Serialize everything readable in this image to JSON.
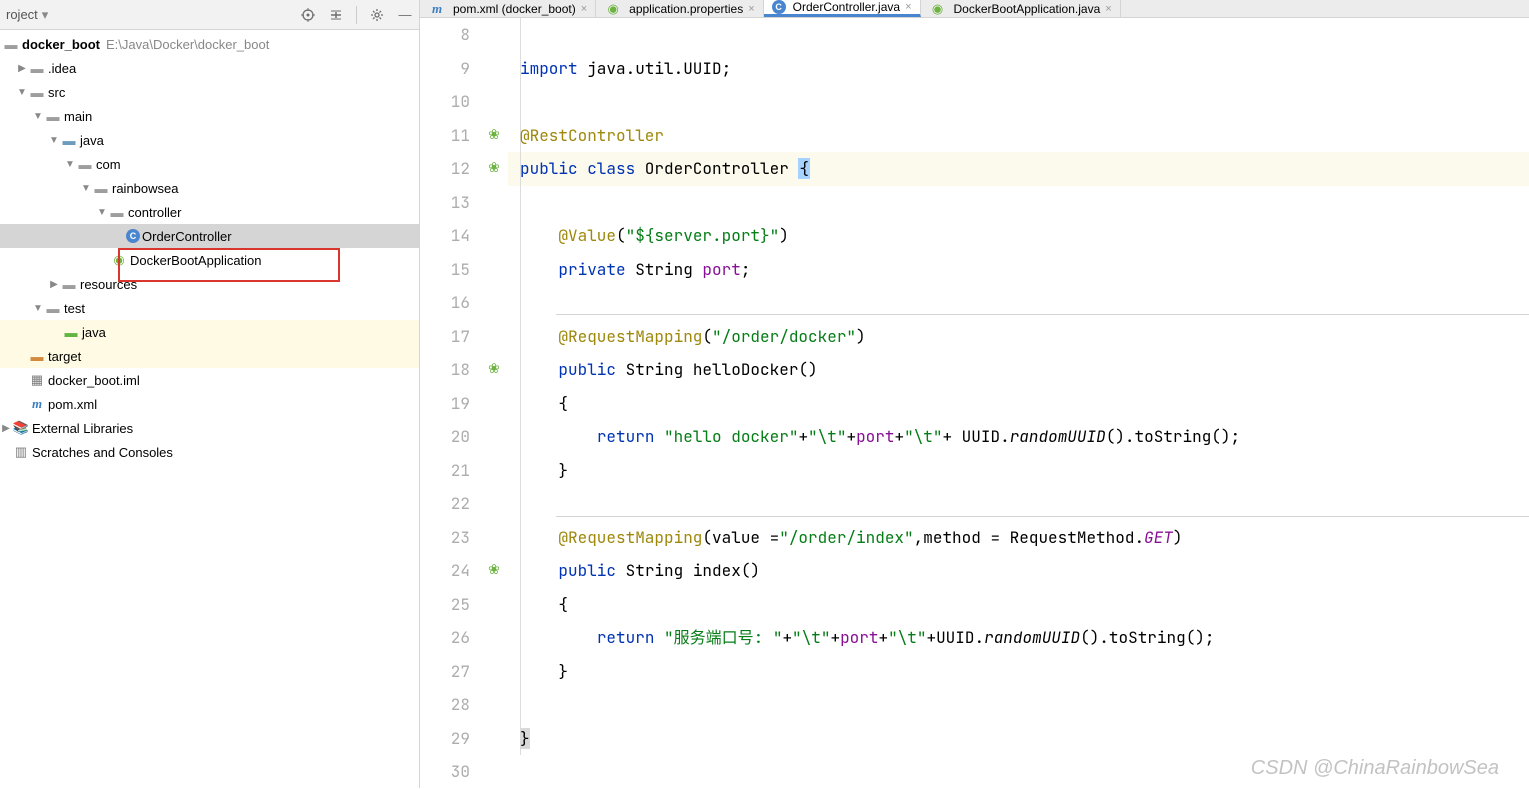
{
  "sidebar": {
    "title": "roject",
    "project": {
      "name": "docker_boot",
      "path": "E:\\Java\\Docker\\docker_boot"
    },
    "nodes": {
      "idea": ".idea",
      "src": "src",
      "main": "main",
      "java": "java",
      "com": "com",
      "rainbowsea": "rainbowsea",
      "controller": "controller",
      "orderController": "OrderController",
      "dockerBootApplication": "DockerBootApplication",
      "resources": "resources",
      "test": "test",
      "testJava": "java",
      "target": "target",
      "iml": "docker_boot.iml",
      "pom": "pom.xml",
      "extLibs": "External Libraries",
      "scratches": "Scratches and Consoles"
    }
  },
  "tabs": [
    {
      "label": "pom.xml (docker_boot)",
      "icon": "maven"
    },
    {
      "label": "application.properties",
      "icon": "spring"
    },
    {
      "label": "OrderController.java",
      "icon": "class",
      "active": true
    },
    {
      "label": "DockerBootApplication.java",
      "icon": "spring"
    }
  ],
  "gutterStart": 8,
  "code": {
    "l9": "import java.util.UUID;",
    "l11": "@RestController",
    "l12_a": "public class",
    "l12_b": " OrderController ",
    "l12_c": "{",
    "l14_a": "@Value",
    "l14_b": "(",
    "l14_c": "\"${server.port}\"",
    "l14_d": ")",
    "l15_a": "private",
    "l15_b": " String ",
    "l15_c": "port",
    "l15_d": ";",
    "l17_a": "@RequestMapping",
    "l17_b": "(",
    "l17_c": "\"/order/docker\"",
    "l17_d": ")",
    "l18_a": "public",
    "l18_b": " String helloDocker()",
    "l19": "    {",
    "l20_a": "return",
    "l20_b": " ",
    "l20_c": "\"hello docker\"",
    "l20_d": "+",
    "l20_e": "\"\\t\"",
    "l20_f": "+",
    "l20_g": "port",
    "l20_h": "+",
    "l20_i": "\"\\t\"",
    "l20_j": "+ UUID.",
    "l20_k": "randomUUID",
    "l20_l": "().toString();",
    "l21": "    }",
    "l23_a": "@RequestMapping",
    "l23_b": "(value =",
    "l23_c": "\"/order/index\"",
    "l23_d": ",method = RequestMethod.",
    "l23_e": "GET",
    "l23_f": ")",
    "l24_a": "public",
    "l24_b": " String index()",
    "l25": "    {",
    "l26_a": "return",
    "l26_b": " ",
    "l26_c": "\"服务端口号: \"",
    "l26_d": "+",
    "l26_e": "\"\\t\"",
    "l26_f": "+",
    "l26_g": "port",
    "l26_h": "+",
    "l26_i": "\"\\t\"",
    "l26_j": "+UUID.",
    "l26_k": "randomUUID",
    "l26_l": "().toString();",
    "l27": "    }",
    "l29": "}"
  },
  "watermark": "CSDN @ChinaRainbowSea"
}
